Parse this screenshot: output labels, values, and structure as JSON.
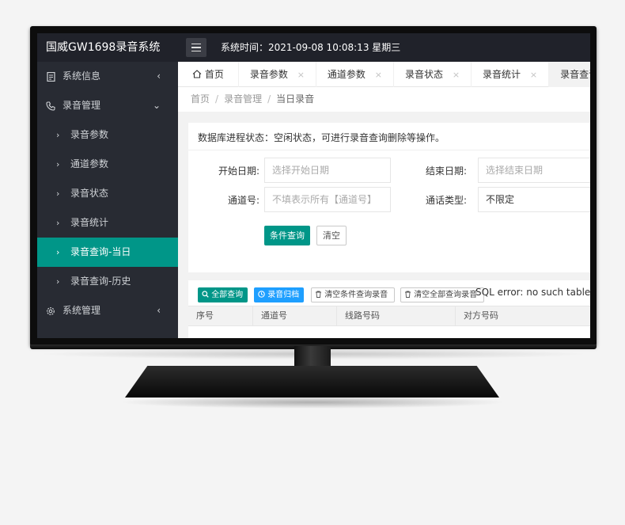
{
  "app": {
    "title": "国威GW1698录音系统",
    "system_time": "系统时间：2021-09-08 10:08:13 星期三"
  },
  "sidebar": {
    "items": [
      {
        "label": "系统信息",
        "icon": "doc-icon",
        "arrow": "‹"
      },
      {
        "label": "录音管理",
        "icon": "phone-icon",
        "arrow": "⌄"
      },
      {
        "label": "录音参数"
      },
      {
        "label": "通道参数"
      },
      {
        "label": "录音状态"
      },
      {
        "label": "录音统计"
      },
      {
        "label": "录音查询-当日"
      },
      {
        "label": "录音查询-历史"
      },
      {
        "label": "系统管理",
        "icon": "gear-icon",
        "arrow": "‹"
      }
    ],
    "sub_arrow": "›"
  },
  "tabs": [
    {
      "label": "首页"
    },
    {
      "label": "录音参数"
    },
    {
      "label": "通道参数"
    },
    {
      "label": "录音状态"
    },
    {
      "label": "录音统计"
    },
    {
      "label": "录音查询-"
    }
  ],
  "tab_close": "×",
  "breadcrumb": {
    "items": [
      "首页",
      "录音管理",
      "当日录音"
    ],
    "sep": "/"
  },
  "query_form": {
    "db_status": "数据库进程状态：空闲状态，可进行录音查询删除等操作。",
    "start_date_label": "开始日期:",
    "start_date_placeholder": "选择开始日期",
    "end_date_label": "结束日期:",
    "end_date_placeholder": "选择结束日期",
    "channel_label": "通道号:",
    "channel_placeholder": "不填表示所有【通道号】",
    "call_type_label": "通话类型:",
    "call_type_value": "不限定",
    "query_button": "条件查询",
    "clear_button": "清空"
  },
  "result_toolbar": {
    "query_all": "全部查询",
    "archive": "录音归档",
    "clear_query": "清空条件查询录音",
    "clear_all": "清空全部查询录音",
    "sql_error": "SQL error: no such table"
  },
  "table": {
    "columns": [
      "序号",
      "通道号",
      "线路号码",
      "对方号码"
    ]
  },
  "colors": {
    "accent": "#009688",
    "blue": "#1e9fff",
    "header_bg": "#20222a",
    "sidebar_bg": "#282b33"
  }
}
